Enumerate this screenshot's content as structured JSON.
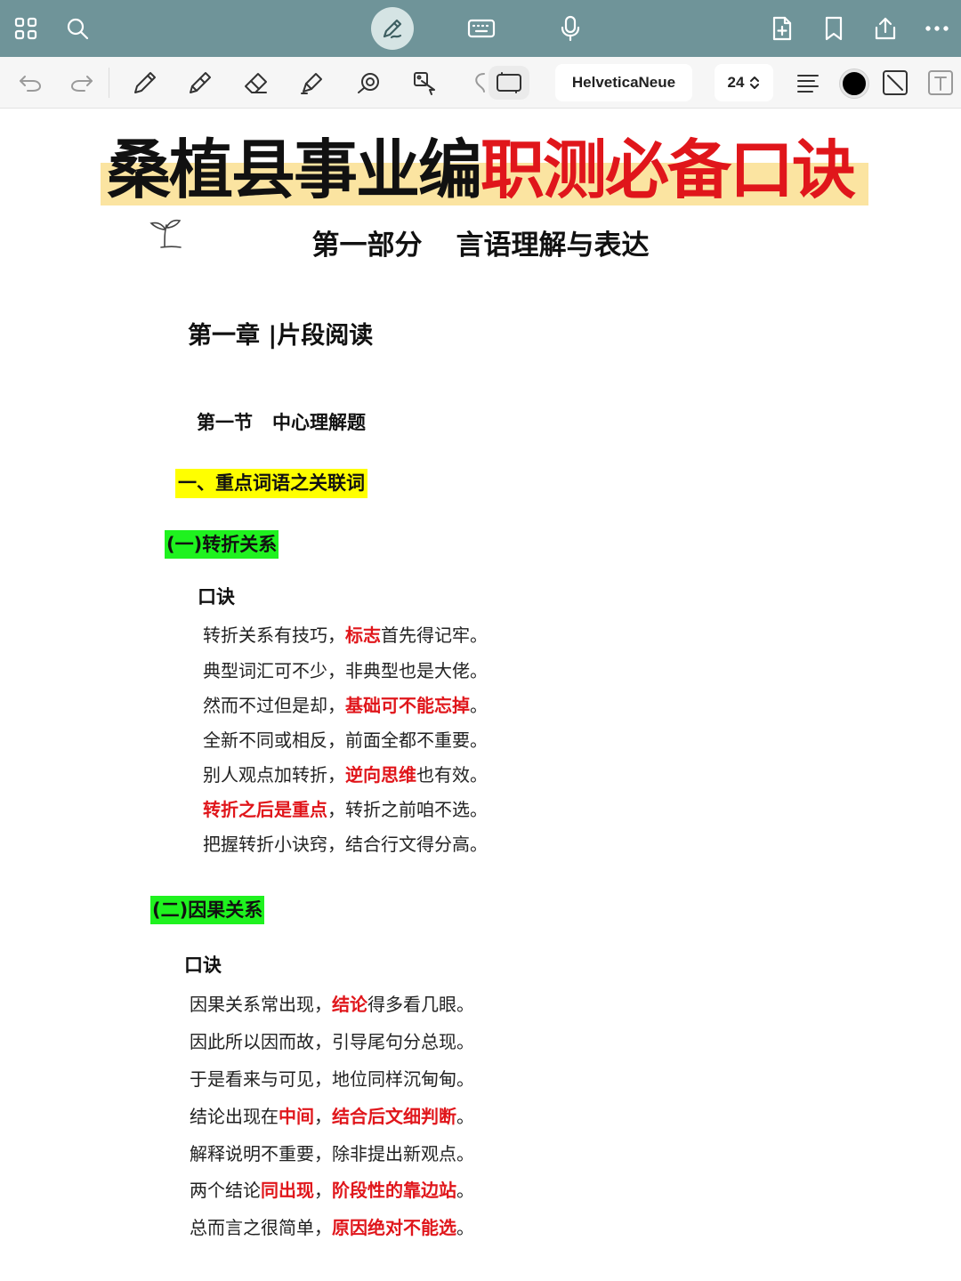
{
  "topbar": {
    "icons": [
      "grid-icon",
      "search-icon",
      "pen-mode-icon",
      "keyboard-icon",
      "microphone-icon",
      "add-page-icon",
      "bookmark-icon",
      "share-icon",
      "more-icon"
    ]
  },
  "toolbar": {
    "font": "HelveticaNeue",
    "size": "24",
    "size_chevron": "⌃⌄",
    "color": "#000000"
  },
  "document": {
    "title_black": "桑植县事业编",
    "title_red": "职测必备口诀",
    "part_num": "第一部分",
    "part_name": "言语理解与表达",
    "chapter": "第一章 |片段阅读",
    "section_num": "第一节",
    "section_name": "中心理解题",
    "heading1": "一、重点词语之关联词",
    "sub1": "(一)转折关系",
    "sub1_label": "口诀",
    "sub1_lines": [
      [
        "转折关系有技巧，",
        "标志",
        "首先得记牢。"
      ],
      [
        "典型词汇可不少，非典型也是大佬。",
        "",
        ""
      ],
      [
        "然而不过但是却，",
        "基础可不能忘掉",
        "。"
      ],
      [
        "全新不同或相反，前面全都不重要。",
        "",
        ""
      ],
      [
        "别人观点加转折，",
        "逆向思维",
        "也有效。"
      ],
      [
        "",
        "转折之后是重点",
        "，转折之前咱不选。"
      ],
      [
        "把握转折小诀窍，结合行文得分高。",
        "",
        ""
      ]
    ],
    "sub2": "(二)因果关系",
    "sub2_label": "口诀",
    "sub2_lines": [
      [
        "因果关系常出现，",
        "结论",
        "得多看几眼。"
      ],
      [
        "因此所以因而故，引导尾句分总现。",
        "",
        ""
      ],
      [
        "于是看来与可见，地位同样沉甸甸。",
        "",
        ""
      ],
      [
        "结论出现在",
        "中间",
        "，",
        "结合后文细判断",
        "。"
      ],
      [
        "解释说明不重要，除非提出新观点。",
        "",
        ""
      ],
      [
        "两个结论",
        "同出现",
        "，",
        "阶段性的靠边站",
        "。"
      ],
      [
        "总而言之很简单，",
        "原因绝对不能选",
        "。"
      ]
    ]
  },
  "colors": {
    "topbar": "#6f9499",
    "title_red": "#e0161b",
    "title_highlight": "#fbe4a1",
    "yellow_highlight": "#ffff00",
    "green_highlight": "#1ff21f"
  }
}
